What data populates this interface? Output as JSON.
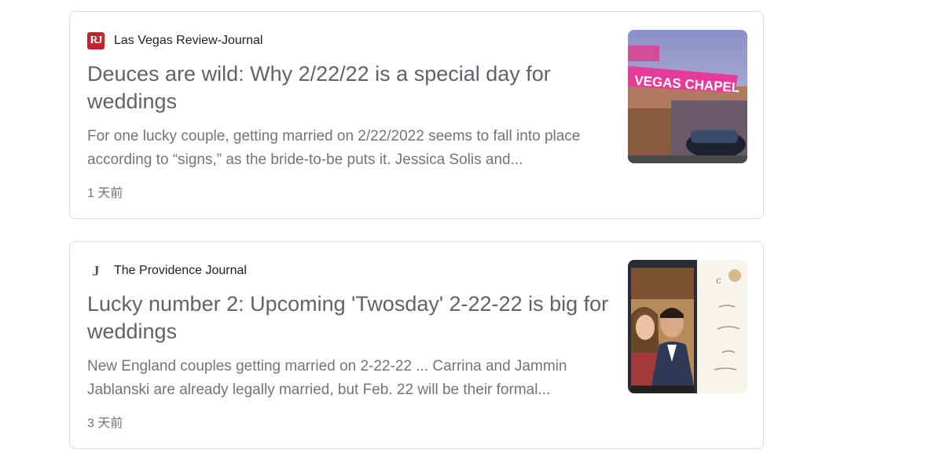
{
  "results": [
    {
      "source_name": "Las Vegas Review-Journal",
      "favicon_text": "RJ",
      "headline": "Deuces are wild: Why 2/22/22 is a special day for weddings",
      "snippet": "For one lucky couple, getting married on 2/22/2022 seems to fall into place according to “signs,” as the bride-to-be puts it. Jessica Solis and...",
      "age": "1 天前",
      "thumbnail_sign_text": "VEGAS CHAPEL"
    },
    {
      "source_name": "The Providence Journal",
      "favicon_text": "J",
      "headline": "Lucky number 2: Upcoming 'Twosday' 2-22-22 is big for weddings",
      "snippet": "New England couples getting married on 2-22-22 ... Carrina and Jammin Jablanski are already legally married, but Feb. 22 will be their formal...",
      "age": "3 天前"
    }
  ],
  "colors": {
    "border": "#dadce0",
    "headline": "#5f6368",
    "snippet": "#70757a",
    "favicon_rj": "#c8232c"
  }
}
